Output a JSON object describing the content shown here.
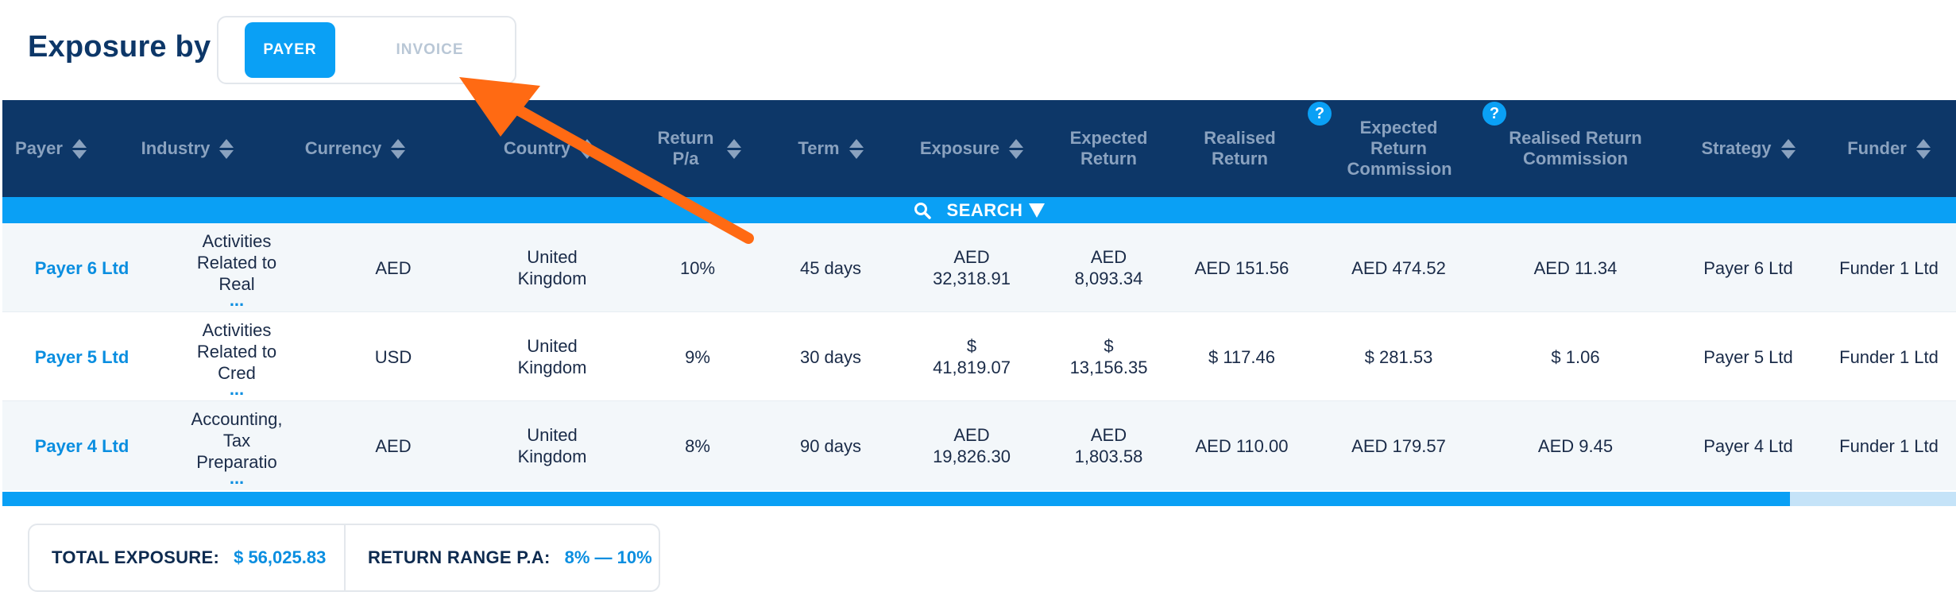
{
  "header": {
    "title": "Exposure by",
    "toggle": {
      "active": "PAYER",
      "inactive": "INVOICE"
    }
  },
  "columns": [
    {
      "label": "Payer",
      "sortable": true
    },
    {
      "label": "Industry",
      "sortable": true
    },
    {
      "label": "Currency",
      "sortable": true
    },
    {
      "label": "Country",
      "sortable": true
    },
    {
      "label": "Return P/a",
      "sortable": true
    },
    {
      "label": "Term",
      "sortable": true
    },
    {
      "label": "Exposure",
      "sortable": true
    },
    {
      "label": "Expected Return",
      "sortable": false
    },
    {
      "label": "Realised Return",
      "sortable": false,
      "help": "?"
    },
    {
      "label": "Expected Return Commission",
      "sortable": false,
      "help": "?"
    },
    {
      "label": "Realised Return Commission",
      "sortable": false
    },
    {
      "label": "Strategy",
      "sortable": true
    },
    {
      "label": "Funder",
      "sortable": true
    }
  ],
  "search": {
    "label": "SEARCH"
  },
  "rows": [
    {
      "payer": "Payer 6 Ltd",
      "industry": [
        "Activities",
        "Related to",
        "Real"
      ],
      "industry_more": "...",
      "currency": "AED",
      "country": [
        "United",
        "Kingdom"
      ],
      "return_pa": "10%",
      "term": "45 days",
      "exposure": [
        "AED",
        "32,318.91"
      ],
      "expected_return": [
        "AED",
        "8,093.34"
      ],
      "realised_return": "AED 151.56",
      "expected_commission": "AED 474.52",
      "realised_commission": "AED 11.34",
      "strategy": "Payer 6 Ltd",
      "funder": "Funder 1 Ltd"
    },
    {
      "payer": "Payer 5 Ltd",
      "industry": [
        "Activities",
        "Related to",
        "Cred"
      ],
      "industry_more": "...",
      "currency": "USD",
      "country": [
        "United",
        "Kingdom"
      ],
      "return_pa": "9%",
      "term": "30 days",
      "exposure": [
        "$",
        "41,819.07"
      ],
      "expected_return": [
        "$",
        "13,156.35"
      ],
      "realised_return": "$ 117.46",
      "expected_commission": "$ 281.53",
      "realised_commission": "$ 1.06",
      "strategy": "Payer 5 Ltd",
      "funder": "Funder 1 Ltd"
    },
    {
      "payer": "Payer 4 Ltd",
      "industry": [
        "Accounting,",
        "Tax",
        "Preparatio"
      ],
      "industry_more": "...",
      "currency": "AED",
      "country": [
        "United",
        "Kingdom"
      ],
      "return_pa": "8%",
      "term": "90 days",
      "exposure": [
        "AED",
        "19,826.30"
      ],
      "expected_return": [
        "AED",
        "1,803.58"
      ],
      "realised_return": "AED 110.00",
      "expected_commission": "AED 179.57",
      "realised_commission": "AED 9.45",
      "strategy": "Payer 4 Ltd",
      "funder": "Funder 1 Ltd"
    }
  ],
  "scroll": {
    "position_fraction": 0.915
  },
  "totals": {
    "exposure_label": "TOTAL EXPOSURE:",
    "exposure_value": "$ 56,025.83",
    "range_label": "RETURN RANGE P.A:",
    "range_value": "8% — 10%"
  },
  "colors": {
    "header_bg": "#0d3768",
    "accent": "#0aa0f5",
    "annotation_arrow": "#ff6a13"
  },
  "icons": [
    "sort-icon",
    "help-icon",
    "search-icon",
    "dropdown-triangle-icon",
    "annotation-arrow"
  ]
}
